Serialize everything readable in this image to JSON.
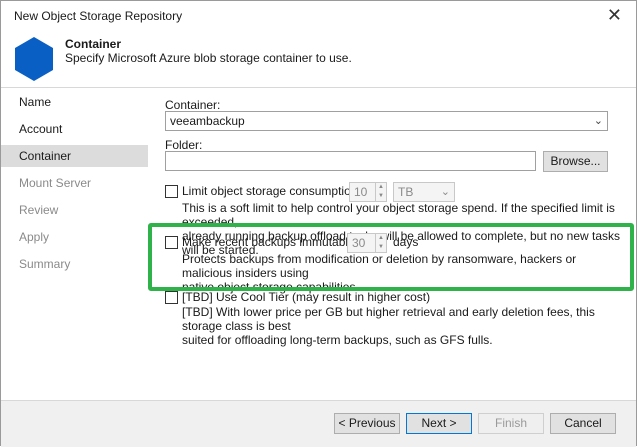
{
  "window": {
    "title": "New Object Storage Repository",
    "close_icon": "close-icon"
  },
  "header": {
    "title": "Container",
    "subtitle": "Specify Microsoft Azure blob storage container to use.",
    "icon": "hexagon-icon",
    "icon_color": "#0a5fc4"
  },
  "sidebar": {
    "items": [
      {
        "label": "Name",
        "state": "normal"
      },
      {
        "label": "Account",
        "state": "normal"
      },
      {
        "label": "Container",
        "state": "selected"
      },
      {
        "label": "Mount Server",
        "state": "disabled"
      },
      {
        "label": "Review",
        "state": "disabled"
      },
      {
        "label": "Apply",
        "state": "disabled"
      },
      {
        "label": "Summary",
        "state": "disabled"
      }
    ]
  },
  "container": {
    "label": "Container:",
    "value": "veeambackup"
  },
  "folder": {
    "label": "Folder:",
    "value": "",
    "browse_label": "Browse..."
  },
  "limit": {
    "label": "Limit object storage consumption to:",
    "checked": false,
    "value": "10",
    "unit": "TB",
    "description_line1": "This is a soft limit to help control your object storage spend. If the specified limit is exceeded,",
    "description_line2": "already running backup offload tasks will be allowed to complete, but no new tasks will be started."
  },
  "immutable": {
    "label": "Make recent backups immutable for:",
    "checked": false,
    "value": "30",
    "unit": "days",
    "description_line1": "Protects backups from modification or deletion by ransomware, hackers or malicious insiders using",
    "description_line2": "native object storage capabilities."
  },
  "cool_tier": {
    "label": "[TBD] Use Cool Tier (may result in higher cost)",
    "checked": false,
    "description_line1": "[TBD] With lower price per GB but higher retrieval and early deletion fees, this storage class is best",
    "description_line2": "suited for offloading long-term backups, such as GFS fulls."
  },
  "footer": {
    "previous_label": "< Previous",
    "next_label": "Next >",
    "finish_label": "Finish",
    "cancel_label": "Cancel"
  },
  "colors": {
    "highlight": "#2fb24a",
    "selected_nav": "#dcdcdc",
    "accent": "#0078d7"
  }
}
